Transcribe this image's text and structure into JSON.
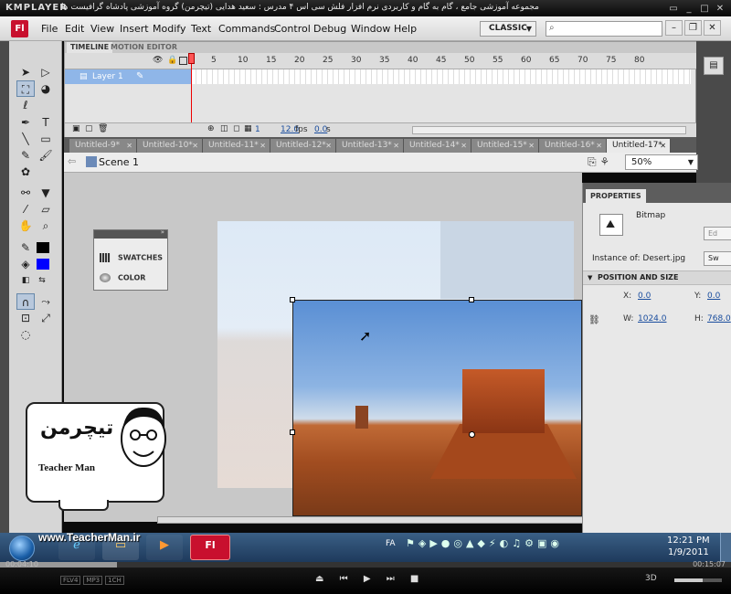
{
  "player": {
    "logo": "KMPLAYER",
    "title": "مجموعه آموزشی جامع ، گام به گام و کاربردی نرم افزار فلش سی اس ۴ مدرس : سعید هدایی (تیچرمن) گروه آموزشی پادشاه گرافیست ها",
    "time_elapsed": "00:04:10",
    "time_total": "00:15:07",
    "tags": [
      "FLV4",
      "MP3",
      "1CH"
    ],
    "three_d": "3D",
    "seek_progress": 0.16,
    "volume_level": 0.6
  },
  "app": {
    "logo": "Fl",
    "menu": [
      "File",
      "Edit",
      "View",
      "Insert",
      "Modify",
      "Text",
      "Commands",
      "Control",
      "Debug",
      "Window",
      "Help"
    ],
    "workspace": "CLASSIC",
    "search_placeholder": ""
  },
  "timeline": {
    "tabs": [
      "TIMELINE",
      "MOTION EDITOR"
    ],
    "frame_numbers": [
      "5",
      "10",
      "15",
      "20",
      "25",
      "30",
      "35",
      "40",
      "45",
      "50",
      "55",
      "60",
      "65",
      "70",
      "75",
      "80"
    ],
    "layer_name": "Layer 1",
    "current_frame": "1",
    "fps": "12.0",
    "fps_unit": "fps",
    "elapsed": "0.0",
    "elapsed_unit": "s"
  },
  "documents": {
    "tabs": [
      "Untitled-9*",
      "Untitled-10*",
      "Untitled-11*",
      "Untitled-12*",
      "Untitled-13*",
      "Untitled-14*",
      "Untitled-15*",
      "Untitled-16*",
      "Untitled-17*"
    ],
    "active_index": 8
  },
  "scene": {
    "label": "Scene 1",
    "zoom": "50%"
  },
  "swatches_panel": {
    "items": [
      "SWATCHES",
      "COLOR"
    ]
  },
  "properties": {
    "tab": "PROPERTIES",
    "type": "Bitmap",
    "edit_label": "Ed",
    "instance_label": "Instance of:",
    "instance_value": "Desert.jpg",
    "swap_label": "Sw",
    "section": "POSITION AND SIZE",
    "x_label": "X:",
    "x_value": "0.0",
    "y_label": "Y:",
    "y_value": "0.0",
    "w_label": "W:",
    "w_value": "1024.0",
    "h_label": "H:",
    "h_value": "768.0"
  },
  "taskbar": {
    "lang": "FA",
    "time": "12:21 PM",
    "date": "1/9/2011",
    "flash_label": "Fl"
  },
  "overlay": {
    "site": "www.TeacherMan.ir",
    "logo_persian": "تیچرمن",
    "logo_name": "Teacher Man"
  },
  "colors": {
    "stroke": "#000000",
    "fill": "#0000ff",
    "flash_red": "#c8102e",
    "layer_highlight": "#8fb6e8"
  }
}
